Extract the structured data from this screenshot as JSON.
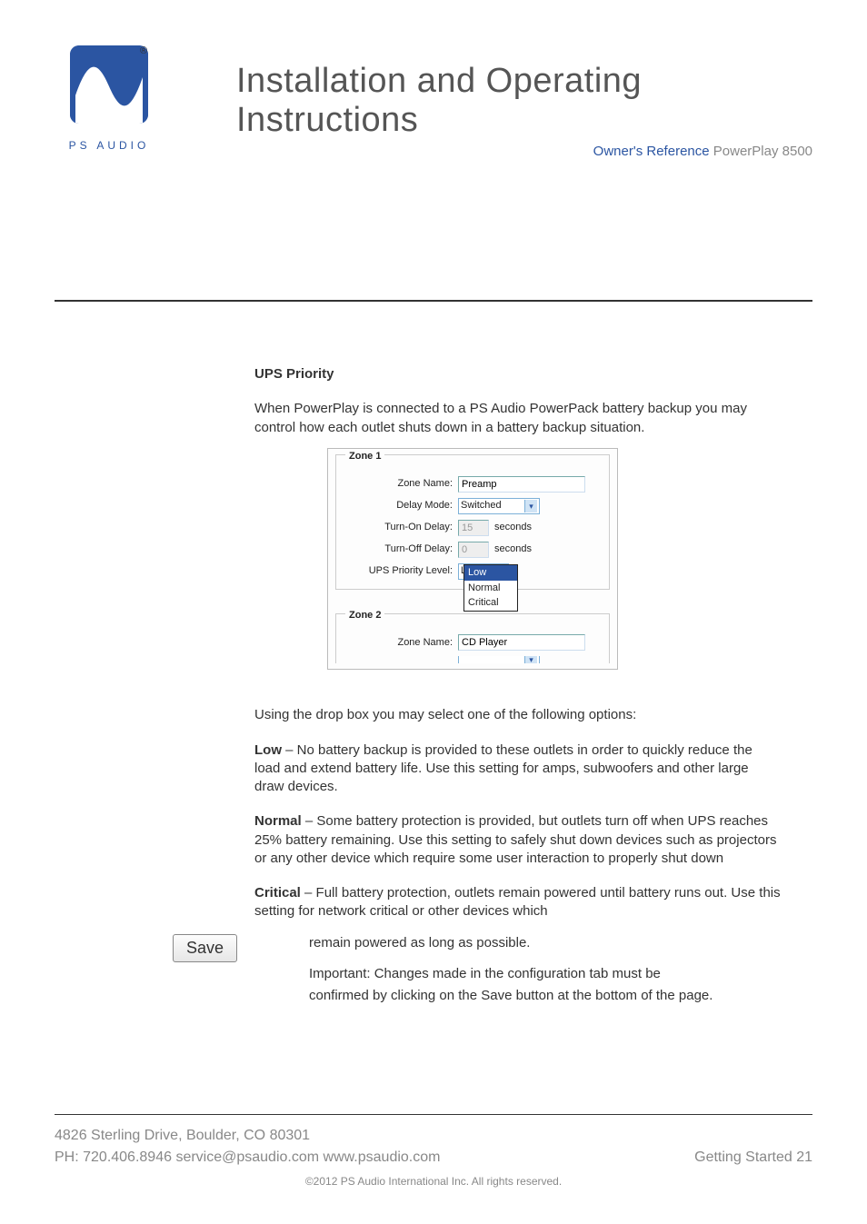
{
  "logo": {
    "brand": "PS AUDIO",
    "registered": "®"
  },
  "title": "Installation and Operating Instructions",
  "owner_ref": {
    "label": "Owner's Reference",
    "product": "PowerPlay 8500"
  },
  "body": {
    "section_title": "UPS Priority",
    "intro": "When PowerPlay is connected to a PS Audio PowerPack battery backup you may control how each outlet shuts down in a battery backup situation.",
    "after_shot": "Using the drop box you may select one of the following options:",
    "options": {
      "low": {
        "label": "Low",
        "desc": " – No battery backup is provided to these outlets in order to quickly reduce the load and extend battery life. Use this setting for amps, subwoofers and other large draw devices."
      },
      "normal": {
        "label": "Normal",
        "desc": " – Some battery protection is provided, but outlets turn off when UPS reaches 25% battery remaining. Use this setting to safely shut down devices such as projectors or any other device which require some user interaction to properly shut down"
      },
      "critical": {
        "label": "Critical",
        "desc": " – Full battery protection, outlets remain powered until battery runs out. Use this setting for network critical or other devices which"
      }
    },
    "critical_tail": "remain powered as long as possible.",
    "save_button": "Save",
    "important1": "Important: Changes made in the configuration tab must be",
    "important2": "confirmed by clicking on the Save button at the bottom of the page."
  },
  "ui": {
    "zone1": {
      "legend": "Zone 1",
      "labels": {
        "name": "Zone Name:",
        "delay_mode": "Delay Mode:",
        "turn_on": "Turn-On Delay:",
        "turn_off": "Turn-Off Delay:",
        "ups": "UPS Priority Level:"
      },
      "values": {
        "name": "Preamp",
        "delay_mode": "Switched",
        "turn_on": "15",
        "turn_off": "0",
        "ups": "Low"
      },
      "unit": "seconds",
      "dropdown_opts": [
        "Low",
        "Normal",
        "Critical"
      ]
    },
    "zone2": {
      "legend": "Zone 2",
      "labels": {
        "name": "Zone Name:"
      },
      "values": {
        "name": "CD Player"
      }
    }
  },
  "footer": {
    "address": "4826 Sterling Drive, Boulder, CO 80301",
    "contact": "PH: 720.406.8946 service@psaudio.com www.psaudio.com",
    "page_note": "Getting Started 21",
    "copyright": "©2012 PS Audio International Inc.  All rights reserved."
  }
}
